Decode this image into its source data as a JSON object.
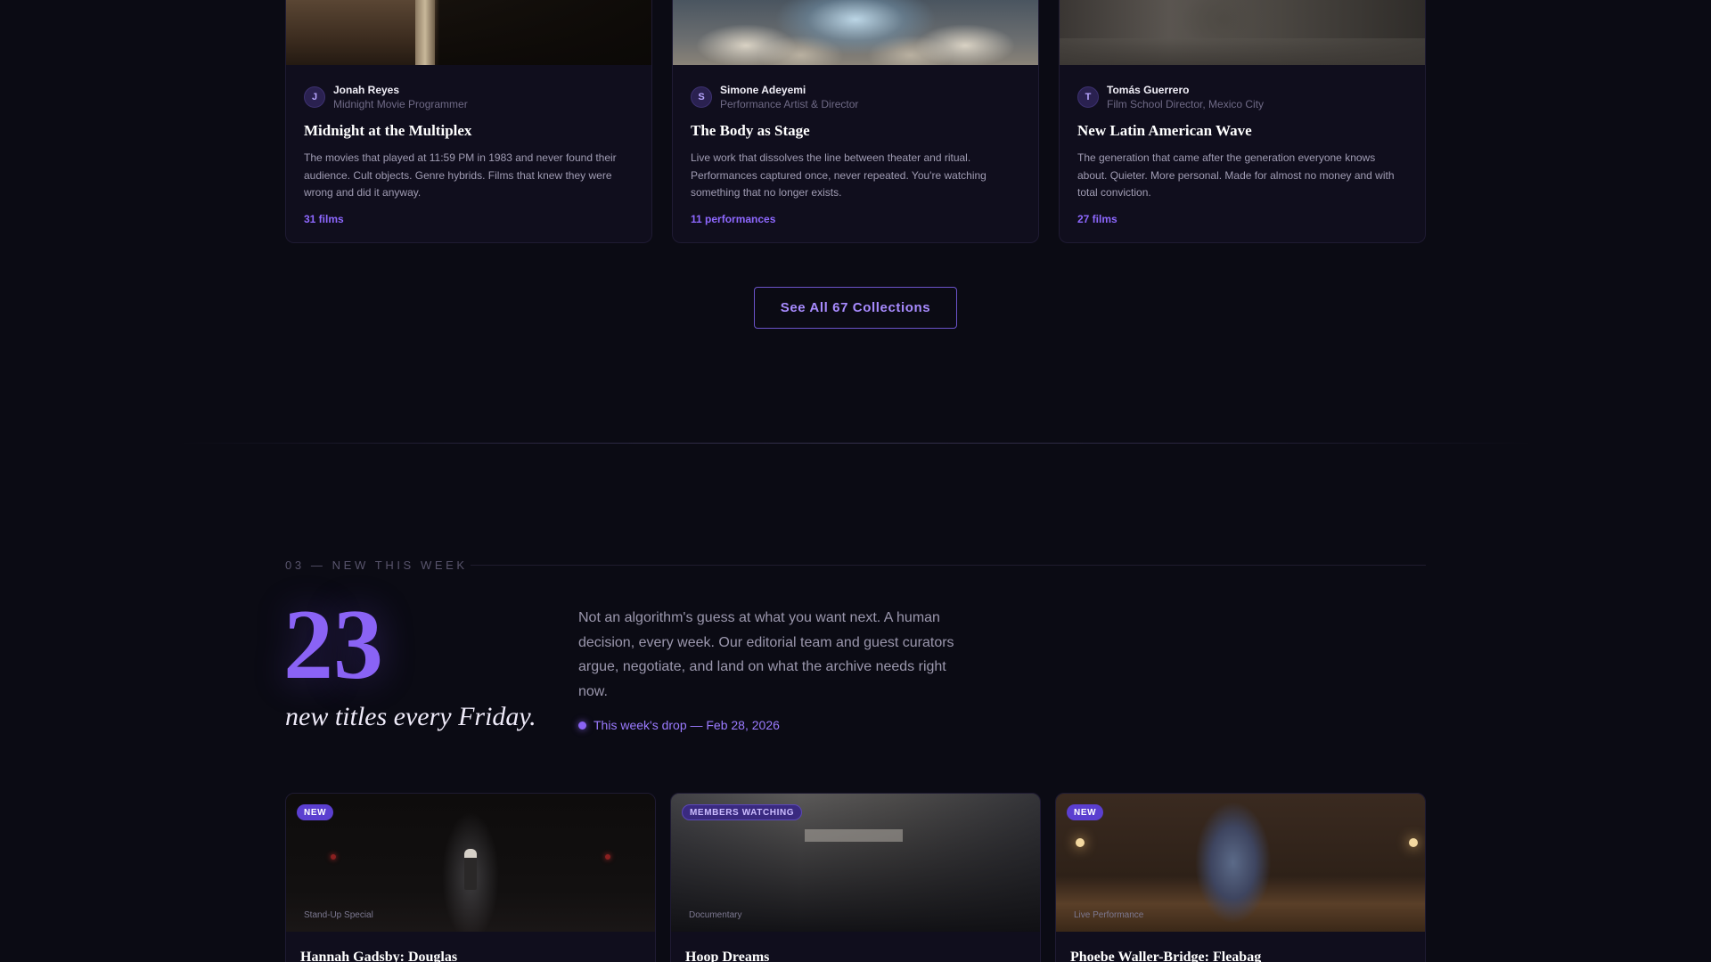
{
  "collections": [
    {
      "curator_initial": "J",
      "curator_name": "Jonah Reyes",
      "curator_role": "Midnight Movie Programmer",
      "title": "Midnight at the Multiplex",
      "description": "The movies that played at 11:59 PM in 1983 and never found their audience. Cult objects. Genre hybrids. Films that knew they were wrong and did it anyway.",
      "count": "31 films"
    },
    {
      "curator_initial": "S",
      "curator_name": "Simone Adeyemi",
      "curator_role": "Performance Artist & Director",
      "title": "The Body as Stage",
      "description": "Live work that dissolves the line between theater and ritual. Performances captured once, never repeated. You're watching something that no longer exists.",
      "count": "11 performances"
    },
    {
      "curator_initial": "T",
      "curator_name": "Tomás Guerrero",
      "curator_role": "Film School Director, Mexico City",
      "title": "New Latin American Wave",
      "description": "The generation that came after the generation everyone knows about. Quieter. More personal. Made for almost no money and with total conviction.",
      "count": "27 films"
    }
  ],
  "see_all_label": "See All 67 Collections",
  "new_this_week": {
    "eyebrow": "03 — NEW THIS WEEK",
    "count": "23",
    "tagline": "new titles every Friday.",
    "blurb": "Not an algorithm's guess at what you want next. A human decision, every week. Our editorial team and guest curators argue, negotiate, and land on what the archive needs right now.",
    "drop_label": "This week's drop — Feb 28, 2026"
  },
  "titles": [
    {
      "badge": "NEW",
      "genre": "Stand-Up Special",
      "title": "Hannah Gadsby: Douglas"
    },
    {
      "badge": "MEMBERS WATCHING",
      "genre": "Documentary",
      "title": "Hoop Dreams"
    },
    {
      "badge": "NEW",
      "genre": "Live Performance",
      "title": "Phoebe Waller-Bridge: Fleabag"
    }
  ],
  "colors": {
    "accent": "#8a63f5",
    "background": "#0b0b14",
    "card": "#100e1d"
  }
}
